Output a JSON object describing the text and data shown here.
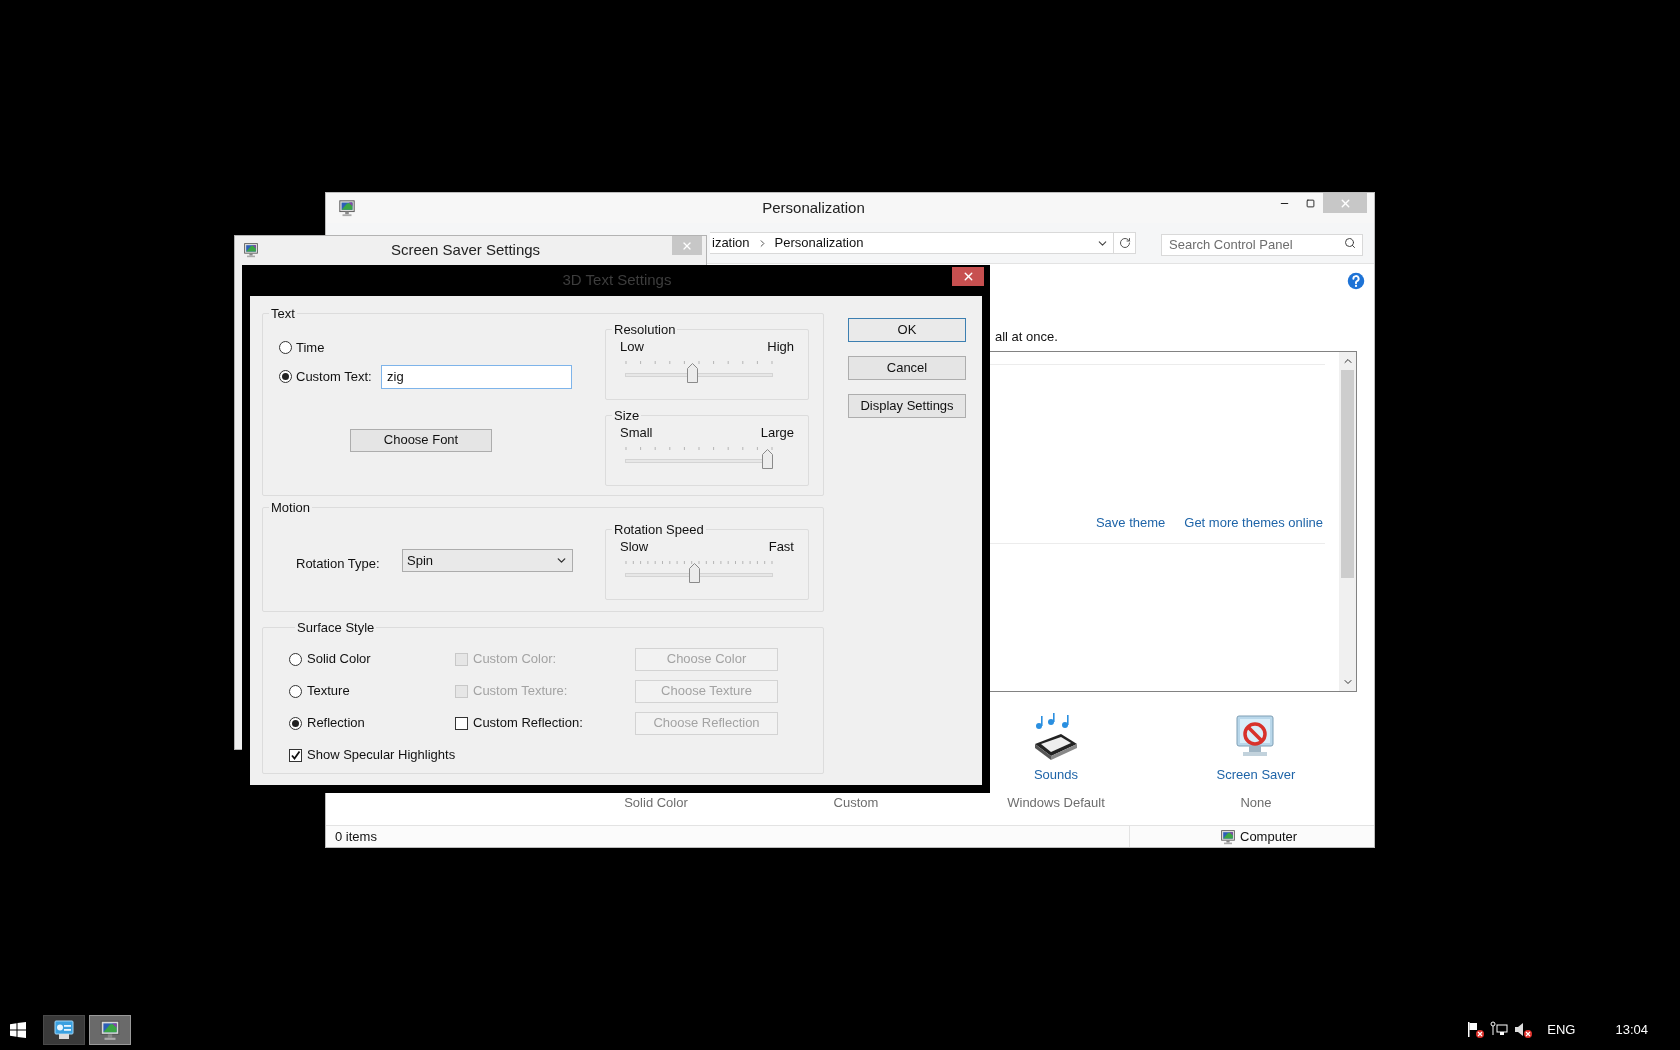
{
  "personalization_window": {
    "title": "Personalization",
    "address": {
      "crumbs": [
        "ization",
        "Personalization"
      ]
    },
    "search": {
      "placeholder": "Search Control Panel"
    },
    "intro_text": "all at once.",
    "theme_links": [
      "Save theme",
      "Get more themes online"
    ],
    "settings": [
      {
        "kind": "partial",
        "value": "Solid Color"
      },
      {
        "kind": "partial",
        "value": "Custom"
      },
      {
        "kind": "sounds",
        "label": "Sounds",
        "value": "Windows Default"
      },
      {
        "kind": "screen_saver",
        "label": "Screen Saver",
        "value": "None"
      }
    ],
    "status_bar": {
      "items": "0 items",
      "location": "Computer"
    }
  },
  "screen_saver_window": {
    "title": "Screen Saver Settings"
  },
  "dialog": {
    "title": "3D Text Settings",
    "text_group": {
      "title": "Text",
      "options": [
        {
          "label": "Time",
          "selected": false
        },
        {
          "label": "Custom Text:",
          "selected": true
        }
      ],
      "custom_text": "zig",
      "choose_font": "Choose Font",
      "sliders": [
        {
          "title": "Resolution",
          "low": "Low",
          "high": "High",
          "level": 0.45
        },
        {
          "title": "Size",
          "low": "Small",
          "high": "Large",
          "level": 1
        }
      ]
    },
    "motion": {
      "title": "Motion",
      "rotation_label": "Rotation Type:",
      "rotation_value": "Spin",
      "slider": {
        "title": "Rotation Speed",
        "low": "Slow",
        "high": "Fast",
        "level": 0.47
      }
    },
    "surface": {
      "title": "Surface Style",
      "rows": [
        {
          "label": "Solid Color",
          "selected": false,
          "check_label": "Custom Color:",
          "checked": false,
          "check_disabled": true,
          "button": "Choose Color",
          "button_disabled": true
        },
        {
          "label": "Texture",
          "selected": false,
          "check_label": "Custom Texture:",
          "checked": false,
          "check_disabled": true,
          "button": "Choose Texture",
          "button_disabled": true
        },
        {
          "label": "Reflection",
          "selected": true,
          "check_label": "Custom Reflection:",
          "checked": false,
          "check_disabled": false,
          "button": "Choose Reflection",
          "button_disabled": true
        }
      ],
      "specular": {
        "label": "Show Specular Highlights",
        "checked": true
      }
    },
    "buttons": [
      {
        "label": "OK",
        "default": true
      },
      {
        "label": "Cancel",
        "default": false
      },
      {
        "label": "Display Settings",
        "default": false
      }
    ]
  },
  "taskbar": {
    "buttons": [
      {
        "kind": "control_panel",
        "selected": false
      },
      {
        "kind": "personalization",
        "selected": true
      }
    ],
    "language": "ENG",
    "time": "13:04"
  }
}
